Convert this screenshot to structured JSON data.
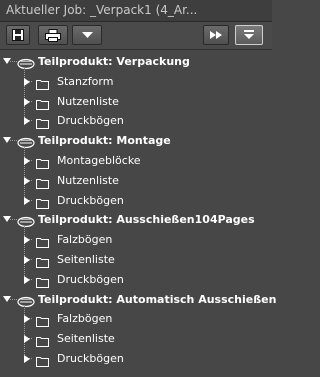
{
  "title": "Aktueller Job: _Verpack1 (4_Ar...",
  "toolbar": {
    "buttons": [
      {
        "name": "save-button",
        "icon": "floppy-disk-icon"
      },
      {
        "name": "print-button",
        "icon": "printer-icon"
      },
      {
        "name": "dropdown-button",
        "icon": "triangle-down-icon"
      },
      {
        "name": "fast-forward-button",
        "icon": "fast-forward-icon"
      },
      {
        "name": "collapse-all-button",
        "icon": "collapse-down-icon"
      }
    ]
  },
  "tree": [
    {
      "label": "Teilprodukt: Verpackung",
      "children": [
        {
          "label": "Stanzform"
        },
        {
          "label": "Nutzenliste"
        },
        {
          "label": "Druckbögen"
        }
      ]
    },
    {
      "label": "Teilprodukt: Montage",
      "children": [
        {
          "label": "Montageblöcke"
        },
        {
          "label": "Nutzenliste"
        },
        {
          "label": "Druckbögen"
        }
      ]
    },
    {
      "label": "Teilprodukt: Ausschießen104Pages",
      "children": [
        {
          "label": "Falzbögen"
        },
        {
          "label": "Seitenliste"
        },
        {
          "label": "Druckbögen"
        }
      ]
    },
    {
      "label": "Teilprodukt: Automatisch Ausschießen",
      "children": [
        {
          "label": "Falzbögen"
        },
        {
          "label": "Seitenliste"
        },
        {
          "label": "Druckbögen"
        }
      ]
    }
  ]
}
